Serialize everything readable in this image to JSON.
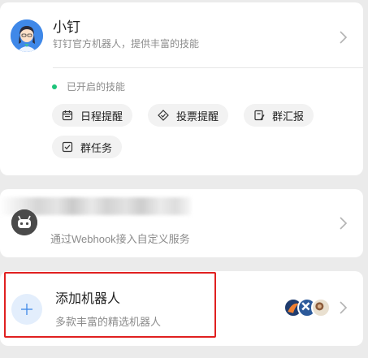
{
  "bot": {
    "name": "小钉",
    "description": "钉钉官方机器人，提供丰富的技能",
    "skills_title": "已开启的技能",
    "skills": [
      {
        "label": "日程提醒",
        "icon": "calendar-icon"
      },
      {
        "label": "投票提醒",
        "icon": "vote-icon"
      },
      {
        "label": "群汇报",
        "icon": "report-icon"
      },
      {
        "label": "群任务",
        "icon": "task-icon"
      }
    ]
  },
  "webhook": {
    "description": "通过Webhook接入自定义服务",
    "icon": "robot-icon"
  },
  "add_robot": {
    "title": "添加机器人",
    "description": "多款丰富的精选机器人",
    "icon": "plus-icon"
  },
  "colors": {
    "accent": "#3f88e8",
    "status_green": "#1dc47a",
    "highlight": "#e02020"
  }
}
